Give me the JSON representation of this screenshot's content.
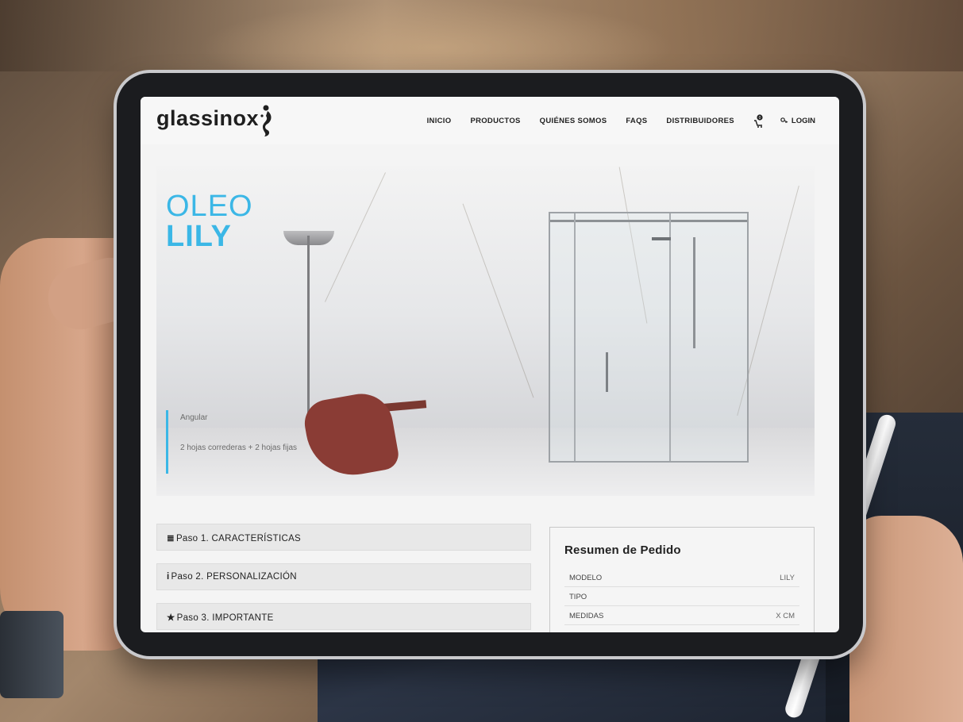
{
  "brand": {
    "name": "glassinox",
    "accent_color": "#3bb7e6"
  },
  "nav": {
    "items": [
      {
        "label": "INICIO"
      },
      {
        "label": "PRODUCTOS"
      },
      {
        "label": "QUIÉNES SOMOS"
      },
      {
        "label": "FAQS"
      },
      {
        "label": "DISTRIBUIDORES"
      }
    ],
    "cart_count": "0",
    "login_label": "LOGIN"
  },
  "hero": {
    "line1": "OLEO",
    "line2": "LILY",
    "type": "Angular",
    "description": "2 hojas correderas + 2 hojas fijas"
  },
  "steps": [
    {
      "icon": "≣",
      "label": "Paso 1. CARACTERÍSTICAS"
    },
    {
      "icon": "i",
      "label": "Paso 2. PERSONALIZACIÓN"
    },
    {
      "icon": "★",
      "label": "Paso 3. IMPORTANTE"
    }
  ],
  "summary": {
    "title": "Resumen de Pedido",
    "rows": [
      {
        "key": "MODELO",
        "value": "LILY"
      },
      {
        "key": "TIPO",
        "value": ""
      },
      {
        "key": "MEDIDAS",
        "value": "X CM"
      }
    ]
  }
}
